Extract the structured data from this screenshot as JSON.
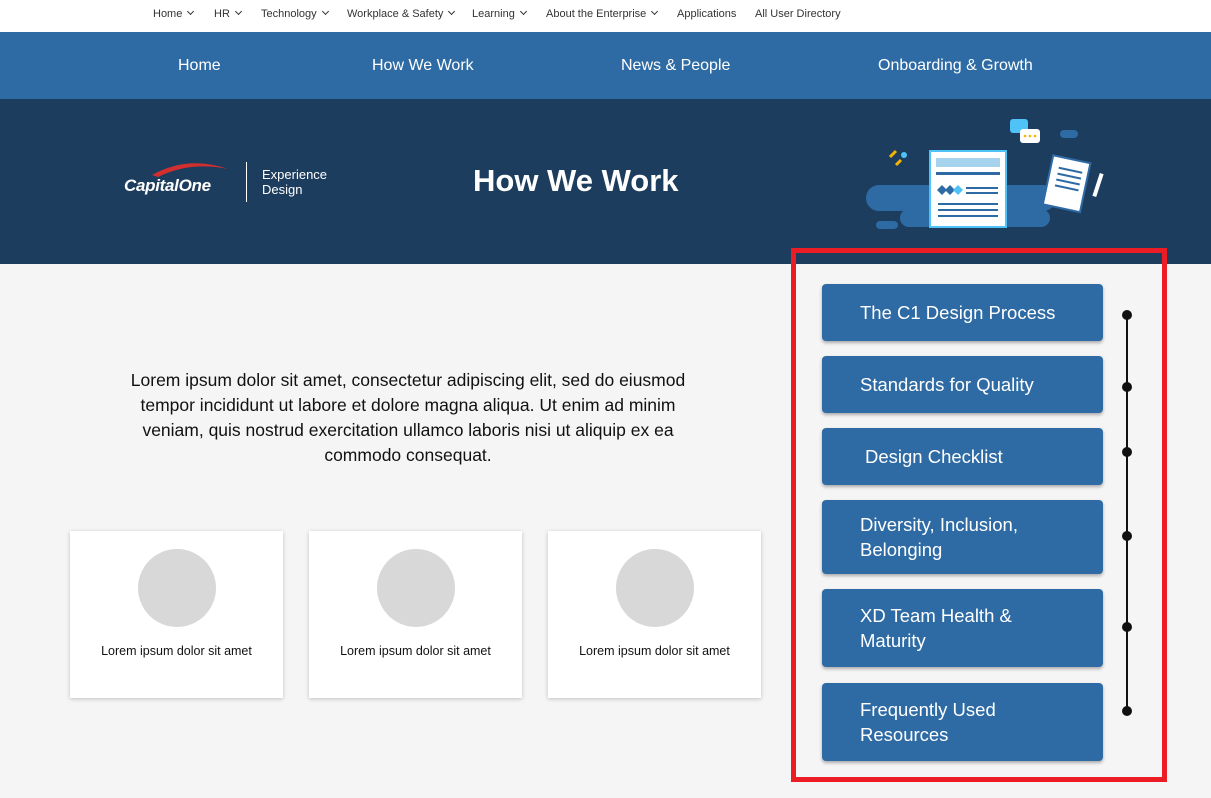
{
  "top_nav": {
    "items": [
      {
        "label": "Home"
      },
      {
        "label": "HR"
      },
      {
        "label": "Technology"
      },
      {
        "label": "Workplace & Safety"
      },
      {
        "label": "Learning"
      },
      {
        "label": "About the Enterprise"
      },
      {
        "label": "Applications"
      },
      {
        "label": "All User Directory"
      }
    ]
  },
  "main_nav": {
    "tabs": [
      {
        "label": "Home"
      },
      {
        "label": "How We Work"
      },
      {
        "label": "News & People"
      },
      {
        "label": "Onboarding & Growth"
      }
    ]
  },
  "hero": {
    "logo_text": "CapitalOne",
    "logo_sub_line1": "Experience",
    "logo_sub_line2": "Design",
    "title": "How We Work"
  },
  "intro_text": "Lorem ipsum dolor sit amet, consectetur adipiscing elit, sed do eiusmod tempor incididunt ut labore et dolore magna aliqua. Ut enim ad minim veniam, quis nostrud exercitation ullamco laboris nisi ut aliquip ex ea commodo consequat.",
  "cards": [
    {
      "caption": "Lorem ipsum dolor sit amet"
    },
    {
      "caption": "Lorem ipsum dolor sit amet"
    },
    {
      "caption": "Lorem ipsum dolor sit amet"
    }
  ],
  "sidebar_links": [
    {
      "label": "The C1 Design Process"
    },
    {
      "label": "Standards for Quality"
    },
    {
      "label": "Design Checklist"
    },
    {
      "label": "Diversity, Inclusion, Belonging"
    },
    {
      "label": "XD Team Health & Maturity"
    },
    {
      "label": "Frequently Used Resources"
    }
  ],
  "colors": {
    "nav_blue": "#2e6ba4",
    "hero_navy": "#1d3d5e",
    "highlight_red": "#ec1c24",
    "page_bg": "#f5f5f5"
  }
}
